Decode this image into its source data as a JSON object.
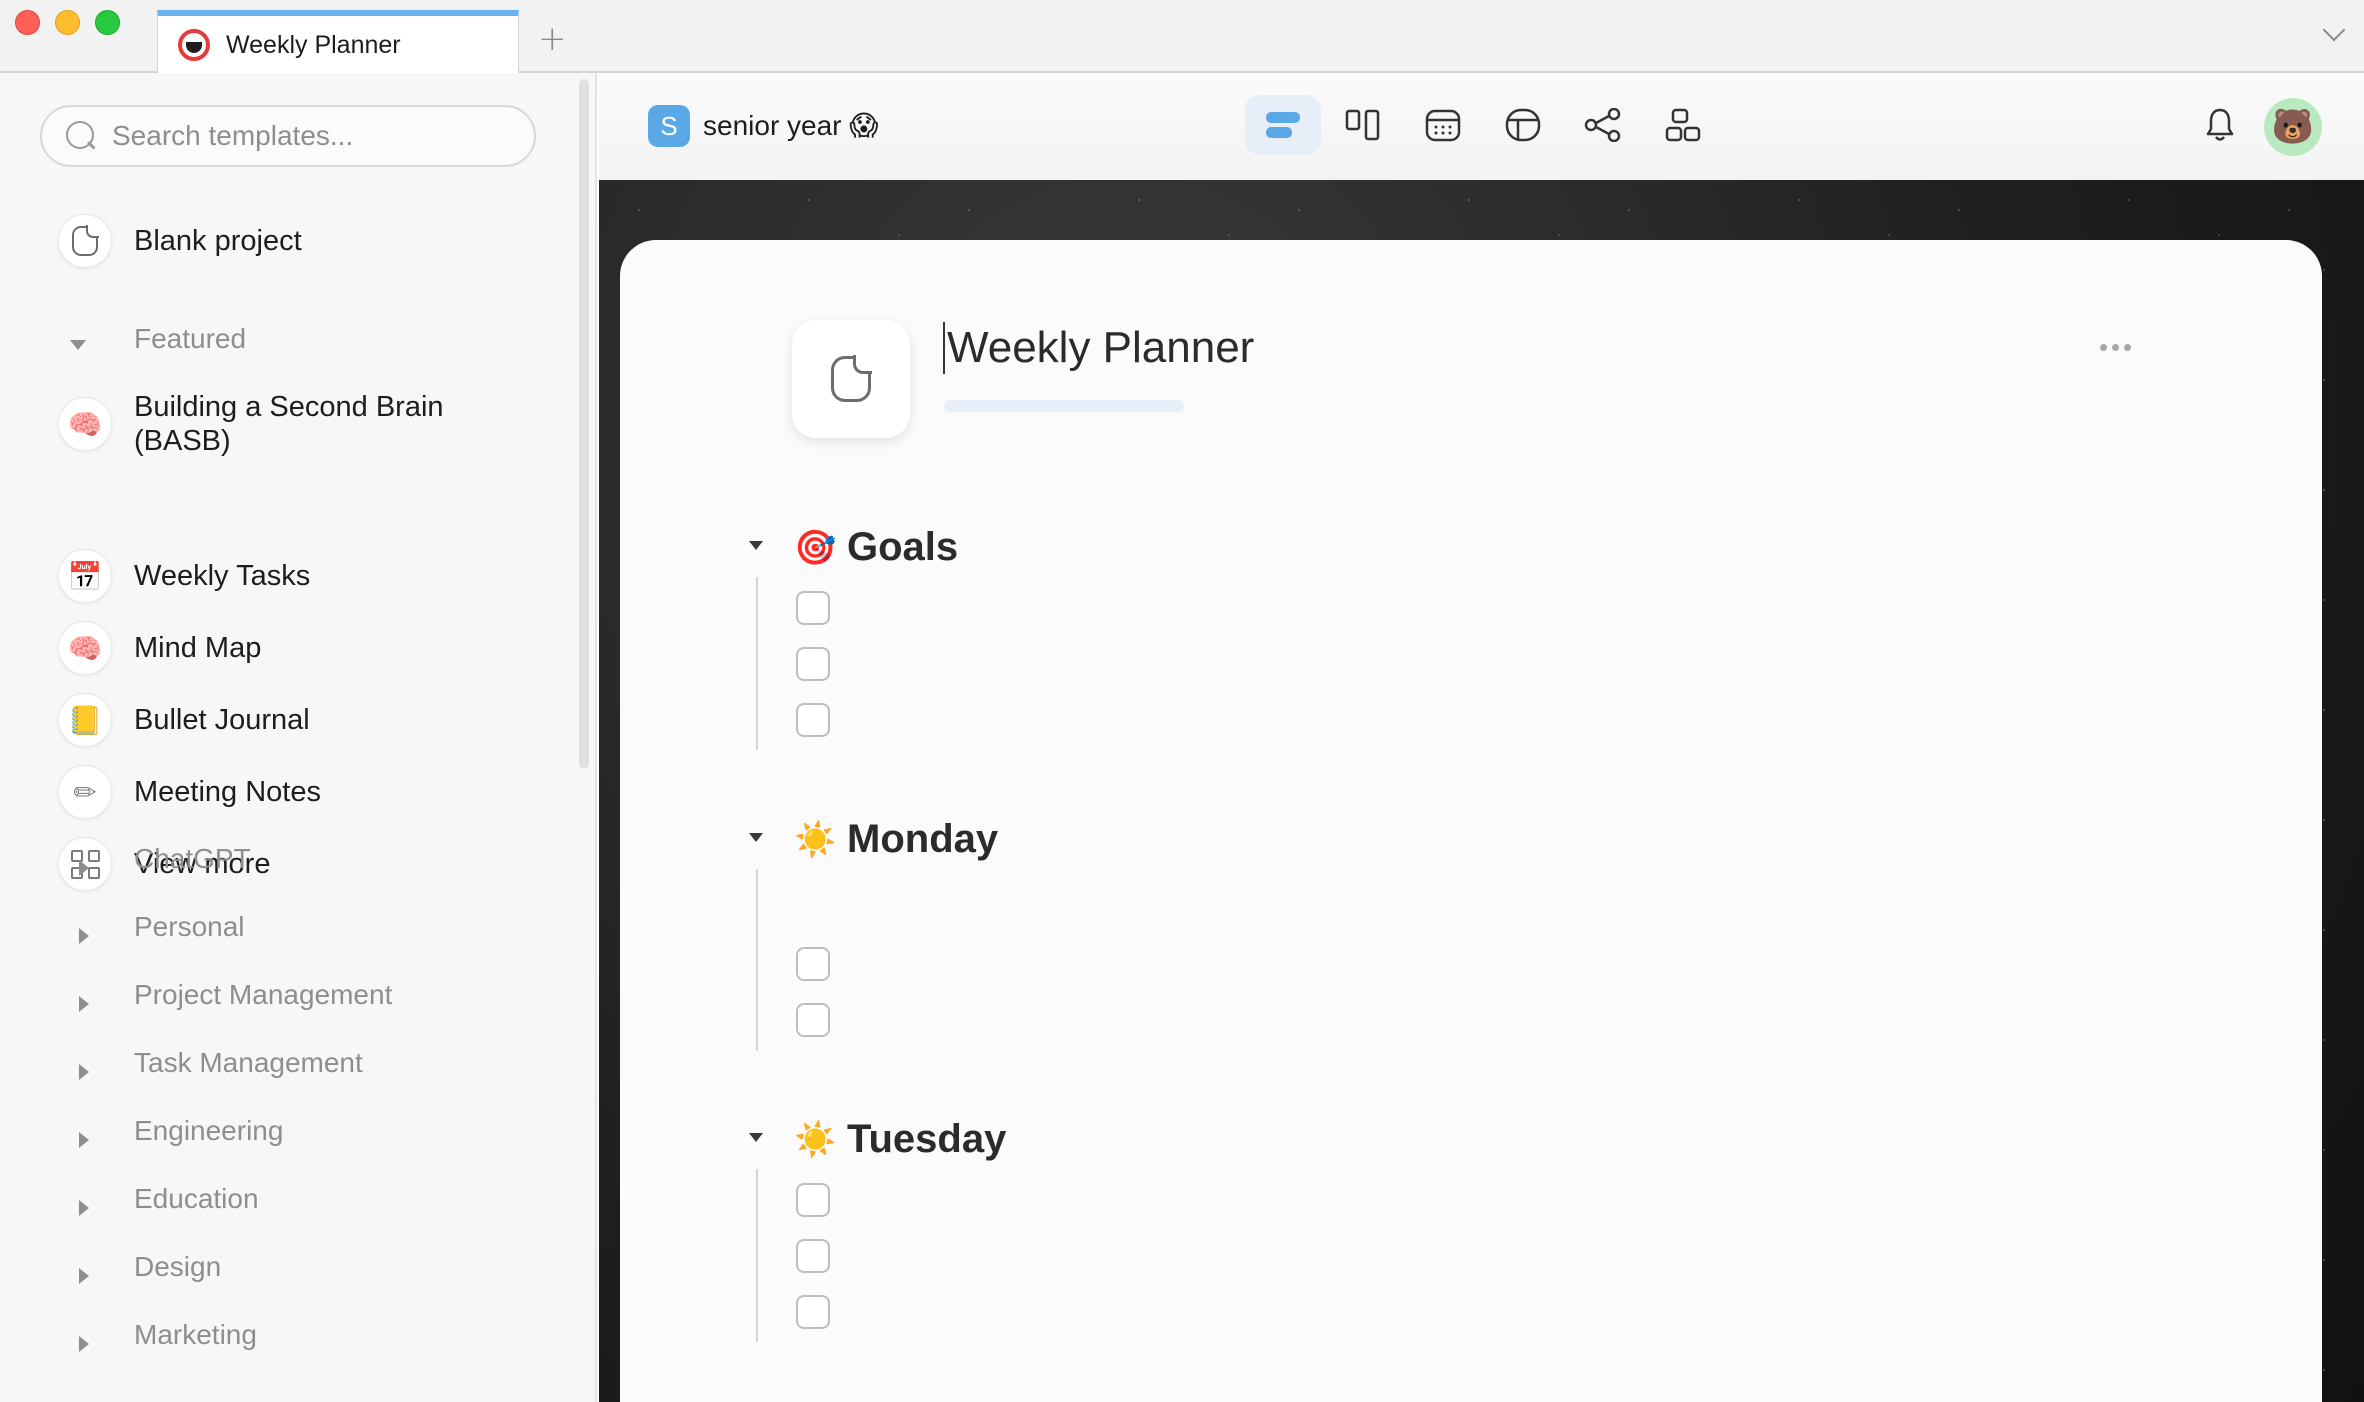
{
  "tab": {
    "title": "Weekly Planner",
    "new_tab": "+"
  },
  "sidebar": {
    "search_placeholder": "Search templates...",
    "blank": {
      "label": "Blank project",
      "icon": "page-icon"
    },
    "featured_label": "Featured",
    "featured": [
      {
        "label": "Building a Second Brain\n(BASB)",
        "emoji": "🧠",
        "icon": "brain-icon"
      },
      {
        "label": "Weekly Tasks",
        "emoji": "📅",
        "icon": "calendar-icon"
      },
      {
        "label": "Mind Map",
        "emoji": "🧠",
        "icon": "brain-icon"
      },
      {
        "label": "Bullet Journal",
        "emoji": "📒",
        "icon": "notebook-icon"
      },
      {
        "label": "Meeting Notes",
        "emoji": "✏",
        "icon": "pencil-icon"
      },
      {
        "label": "View more",
        "icon": "grid-icon"
      }
    ],
    "categories": [
      "ChatGPT",
      "Personal",
      "Project Management",
      "Task Management",
      "Engineering",
      "Education",
      "Design",
      "Marketing"
    ]
  },
  "toolbar": {
    "workspace_initial": "S",
    "workspace_name": "senior year 😱",
    "views": [
      "outline-view",
      "board-view",
      "calendar-view",
      "table-view",
      "mindmap-view",
      "widgets-view"
    ],
    "avatar_emoji": "🐻"
  },
  "document": {
    "title": "Weekly Planner",
    "sections": [
      {
        "emoji": "🎯",
        "title": "Goals",
        "checkboxes": 3
      },
      {
        "emoji": "☀️",
        "title": "Monday",
        "checkboxes": 2
      },
      {
        "emoji": "☀️",
        "title": "Tuesday",
        "checkboxes": 3
      }
    ]
  },
  "colors": {
    "accent": "#6ab4ee",
    "workspace_badge": "#5aa9e6",
    "avatar_bg": "#b9eabf"
  }
}
